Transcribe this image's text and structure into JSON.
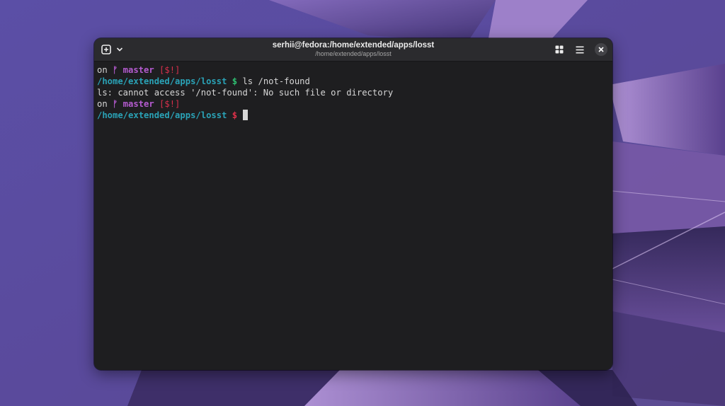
{
  "colors": {
    "window_bg": "#1e1e20",
    "titlebar_bg": "#2b2b2e",
    "branch": "#b45bcf",
    "status": "#d9304c",
    "path": "#2aa2b6",
    "prompt_ok": "#2fbf71",
    "prompt_err": "#e0314a",
    "text": "#d6d6d6"
  },
  "titlebar": {
    "title": "serhii@fedora:/home/extended/apps/losst",
    "subtitle": "/home/extended/apps/losst",
    "new_tab_icon": "plus-square-icon",
    "tab_menu_icon": "chevron-down-icon",
    "overview_icon": "grid-icon",
    "menu_icon": "hamburger-menu-icon",
    "close_icon": "close-icon"
  },
  "terminal": {
    "lines": [
      {
        "on": "on ",
        "branch": "ᚠ master",
        "status": "[$!]"
      },
      {
        "path": "/home/extended/apps/losst",
        "dollar": "$",
        "command": "ls /not-found"
      },
      {
        "output": "ls: cannot access '/not-found': No such file or directory"
      },
      {
        "on": "on ",
        "branch": "ᚠ master",
        "status": "[$!]"
      },
      {
        "path": "/home/extended/apps/losst",
        "dollar": "$",
        "command": ""
      }
    ]
  }
}
